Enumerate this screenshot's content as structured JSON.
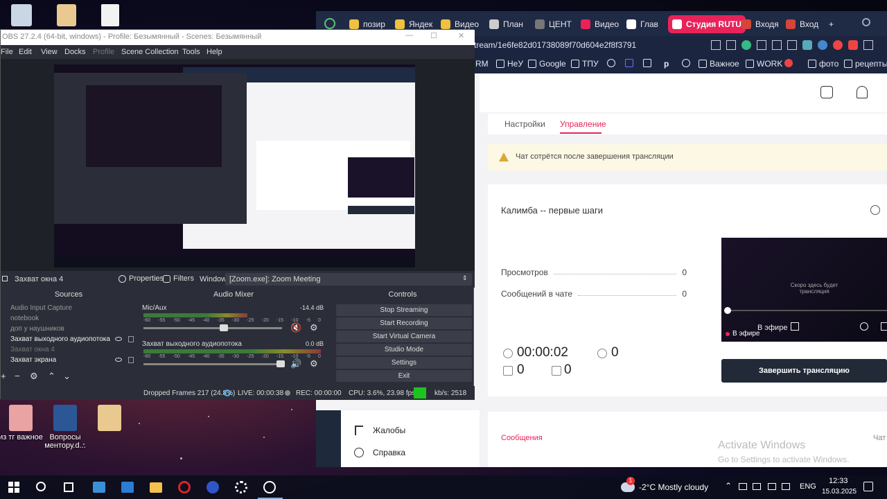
{
  "desktop": {
    "icons": [
      {
        "label": "из тг важное",
        "color": "#e9a3a3"
      },
      {
        "label": "Вопросы ментору.d...",
        "color": "#2b5797"
      },
      {
        "label": "",
        "color": "#e9c98f"
      }
    ]
  },
  "browser": {
    "tabs": [
      {
        "label": "позир",
        "color": "#f0c040"
      },
      {
        "label": "Яндек",
        "color": "#f0c040"
      },
      {
        "label": "Видео",
        "color": "#f0c040"
      },
      {
        "label": "План",
        "color": "#cccccc"
      },
      {
        "label": "ЦЕНТ",
        "color": "#777777"
      },
      {
        "label": "Видео",
        "color": "#e8235a"
      },
      {
        "label": "Глав",
        "color": "#ffffff"
      },
      {
        "label": "Студия RUTU",
        "color": "#ffffff",
        "active": true
      },
      {
        "label": "Входя",
        "color": "#d44638"
      },
      {
        "label": "Вход",
        "color": "#d44638"
      }
    ],
    "add_tab": "+",
    "address": "tream/1e6fe82d01738089f70d604e2f8f3791",
    "bookmarks": [
      "RM",
      "НеУ",
      "Google",
      "ТПУ",
      "",
      "",
      "",
      "р",
      "Важное",
      "WORK",
      "",
      "фото",
      "рецепты"
    ],
    "page": {
      "tabs": [
        "Настройки",
        "Управление"
      ],
      "notice": "Чат сотрётся после завершения трансляции",
      "stream_title": "Калимба -- первые шаги",
      "stats": [
        {
          "label": "Просмотров",
          "value": "0"
        },
        {
          "label": "Сообщений в чате",
          "value": "0"
        }
      ],
      "timer": "00:00:02",
      "viewers": "0",
      "likes": "0",
      "dislikes": "0",
      "video_overlay": "Скоро здесь будет трансляция",
      "live_badge": "В эфире",
      "live_label": "В эфире",
      "end_button": "Завершить трансляцию",
      "messages_tab": "Сообщения",
      "chat_label": "Чат",
      "side_menu": [
        "Жалобы",
        "Справка"
      ],
      "watermark_title": "Activate Windows",
      "watermark_sub": "Go to Settings to activate Windows."
    }
  },
  "obs": {
    "title": "OBS 27.2.4 (64-bit, windows) - Profile: Безымянный - Scenes: Безымянный",
    "menu": [
      "File",
      "Edit",
      "View",
      "Docks",
      "Profile",
      "Scene Collection",
      "Tools",
      "Help"
    ],
    "source_bar": {
      "current": "Захват окна 4",
      "properties": "Properties",
      "filters": "Filters",
      "window_label": "Window",
      "window_value": "[Zoom.exe]: Zoom Meeting"
    },
    "docks": {
      "sources": "Sources",
      "mixer": "Audio Mixer",
      "controls": "Controls"
    },
    "sources": [
      "Audio Input Capture",
      "notebook",
      "доп у наушников",
      "Захват выходного аудиопотока",
      "Захват окна 4",
      "Захват экрана"
    ],
    "mixer": [
      {
        "name": "Mic/Aux",
        "db": "-14.4 dB"
      },
      {
        "name": "Захват выходного аудиопотока",
        "db": "0.0 dB"
      }
    ],
    "scale": [
      "-60",
      "-55",
      "-50",
      "-45",
      "-40",
      "-35",
      "-30",
      "-25",
      "-20",
      "-15",
      "-10",
      "-5",
      "0"
    ],
    "controls": [
      "Stop Streaming",
      "Start Recording",
      "Start Virtual Camera",
      "Studio Mode",
      "Settings",
      "Exit"
    ],
    "status": {
      "dropped": "Dropped Frames 217 (24.8%)",
      "live": "LIVE: 00:00:38",
      "rec": "REC: 00:00:00",
      "cpu": "CPU: 3.6%, 23.98 fps",
      "kbs": "kb/s: 2518"
    }
  },
  "taskbar": {
    "weather": "-2°C  Mostly cloudy",
    "lang": "ENG",
    "time": "12:33",
    "date": "15.03.2025",
    "notif_badge": "1"
  }
}
